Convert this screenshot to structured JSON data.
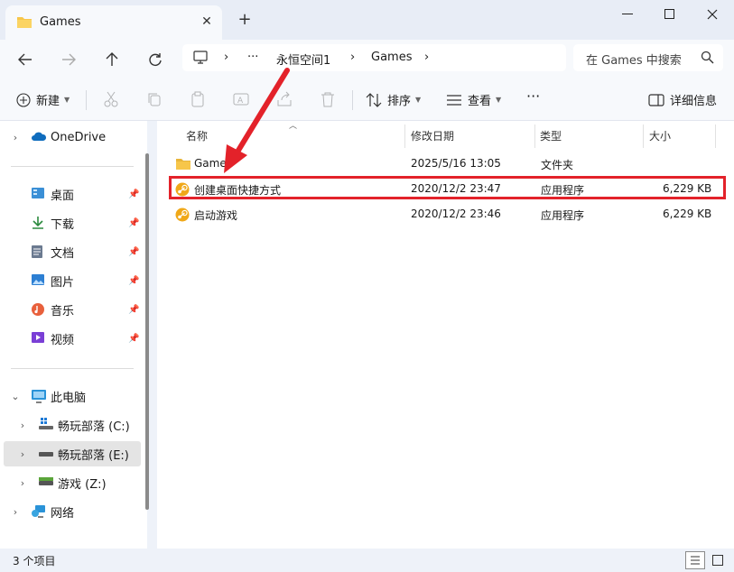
{
  "tab": {
    "title": "Games",
    "close": "✕",
    "new": "+"
  },
  "window": {
    "minimize": "—",
    "maximize": "☐",
    "close": "✕"
  },
  "address": {
    "more": "···",
    "sep": "›",
    "crumbs": [
      "永恒空间1",
      "Games"
    ],
    "search_placeholder": "在 Games 中搜索"
  },
  "toolbar": {
    "new_label": "新建",
    "sort_label": "排序",
    "view_label": "查看",
    "more_label": "···",
    "details_label": "详细信息"
  },
  "sidebar": {
    "onedrive": "OneDrive",
    "quick": [
      "桌面",
      "下载",
      "文档",
      "图片",
      "音乐",
      "视频"
    ],
    "pc": "此电脑",
    "drives": [
      "畅玩部落 (C:)",
      "畅玩部落 (E:)",
      "游戏 (Z:)"
    ],
    "network": "网络"
  },
  "columns": {
    "name": "名称",
    "modified": "修改日期",
    "type": "类型",
    "size": "大小"
  },
  "files": [
    {
      "name": "Game",
      "modified": "2025/5/16 13:05",
      "type": "文件夹",
      "size": ""
    },
    {
      "name": "创建桌面快捷方式",
      "modified": "2020/12/2 23:47",
      "type": "应用程序",
      "size": "6,229 KB"
    },
    {
      "name": "启动游戏",
      "modified": "2020/12/2 23:46",
      "type": "应用程序",
      "size": "6,229 KB"
    }
  ],
  "status": {
    "count": "3 个项目"
  },
  "colors": {
    "highlight": "#e3222a",
    "folder": "#f7c64a",
    "steam": "#f0a818"
  }
}
